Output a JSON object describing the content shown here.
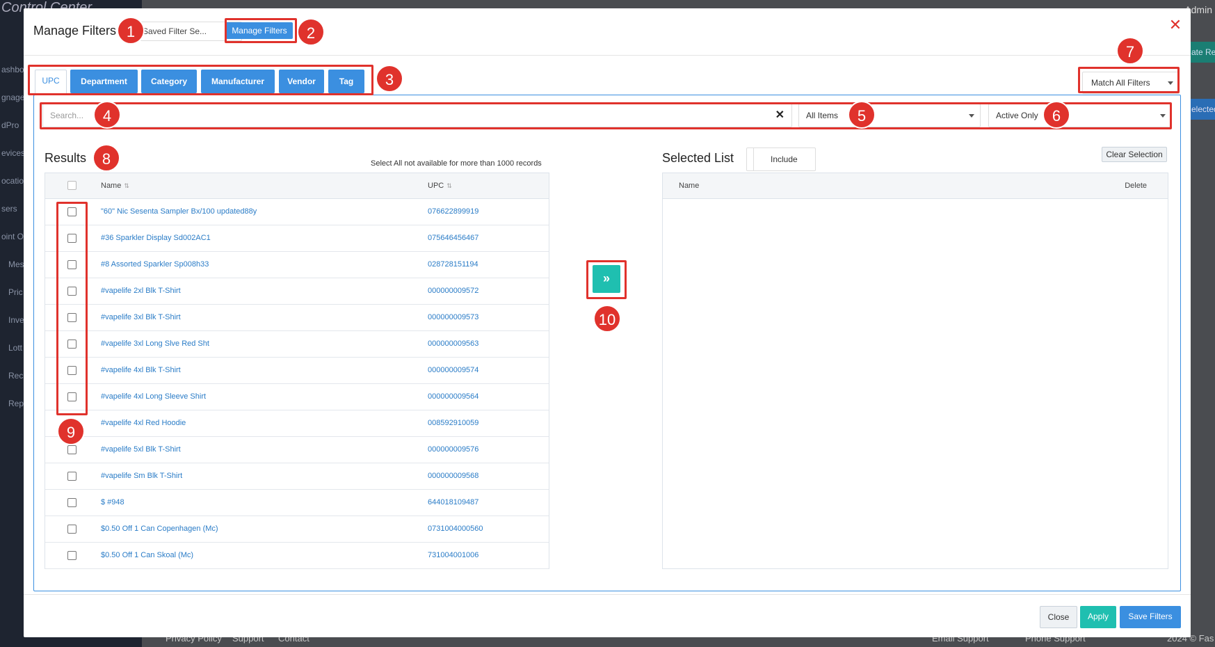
{
  "background": {
    "brand": "Control Center",
    "nav": [
      "ashboard",
      "gnage",
      "dPro",
      "evices",
      "ocations",
      "sers",
      "oint Of",
      "Mes",
      "Pric",
      "Inve",
      "Lott",
      "Rec",
      "Rep"
    ],
    "admin_label": "Admin",
    "right_btn_1": "ate Rep",
    "right_btn_2": "elected",
    "footer": {
      "privacy": "Privacy Policy",
      "support": "Support",
      "contact": "Contact",
      "email": "Email Support",
      "phone": "Phone Support",
      "copyright": "2024 © Fas"
    }
  },
  "modal": {
    "title": "Manage Filters",
    "saved_filter_placeholder": "Saved Filter Se...",
    "manage_button": "Manage Filters",
    "close_icon": "close-icon",
    "tabs": [
      {
        "label": "UPC",
        "active": true
      },
      {
        "label": "Department",
        "active": false
      },
      {
        "label": "Category",
        "active": false
      },
      {
        "label": "Manufacturer",
        "active": false
      },
      {
        "label": "Vendor",
        "active": false
      },
      {
        "label": "Tag",
        "active": false
      }
    ],
    "match_select": "Match All Filters",
    "search": {
      "placeholder": "Search...",
      "value": ""
    },
    "items_select": "All Items",
    "active_select": "Active Only",
    "results": {
      "title": "Results",
      "note": "Select All not available for more than 1000 records",
      "columns": {
        "name": "Name",
        "upc": "UPC"
      },
      "rows": [
        {
          "name": "\"60\" Nic Sesenta Sampler Bx/100 updated88y",
          "upc": "076622899919"
        },
        {
          "name": "#36 Sparkler Display Sd002AC1",
          "upc": "075646456467"
        },
        {
          "name": "#8 Assorted Sparkler Sp008h33",
          "upc": "028728151194"
        },
        {
          "name": "#vapelife 2xl Blk T-Shirt",
          "upc": "000000009572"
        },
        {
          "name": "#vapelife 3xl Blk T-Shirt",
          "upc": "000000009573"
        },
        {
          "name": "#vapelife 3xl Long Slve Red Sht",
          "upc": "000000009563"
        },
        {
          "name": "#vapelife 4xl Blk T-Shirt",
          "upc": "000000009574"
        },
        {
          "name": "#vapelife 4xl Long Sleeve Shirt",
          "upc": "000000009564"
        },
        {
          "name": "#vapelife 4xl Red Hoodie",
          "upc": "008592910059"
        },
        {
          "name": "#vapelife 5xl Blk T-Shirt",
          "upc": "000000009576"
        },
        {
          "name": "#vapelife Sm Blk T-Shirt",
          "upc": "000000009568"
        },
        {
          "name": "$ #948",
          "upc": "644018109487"
        },
        {
          "name": "$0.50 Off 1 Can Copenhagen (Mc)",
          "upc": "0731004000560"
        },
        {
          "name": "$0.50 Off 1 Can Skoal (Mc)",
          "upc": "731004001006"
        }
      ]
    },
    "move_button": "»",
    "selected": {
      "title": "Selected List",
      "include_label": "Include",
      "clear_button": "Clear Selection",
      "columns": {
        "name": "Name",
        "delete": "Delete"
      }
    },
    "footer": {
      "close": "Close",
      "apply": "Apply",
      "save": "Save Filters"
    }
  },
  "annotations": [
    "1",
    "2",
    "3",
    "4",
    "5",
    "6",
    "7",
    "8",
    "9",
    "10"
  ],
  "colors": {
    "accent": "#3b8fe0",
    "teal": "#1fbfb0",
    "annotation": "#e0322c",
    "link": "#2a7cc7"
  }
}
